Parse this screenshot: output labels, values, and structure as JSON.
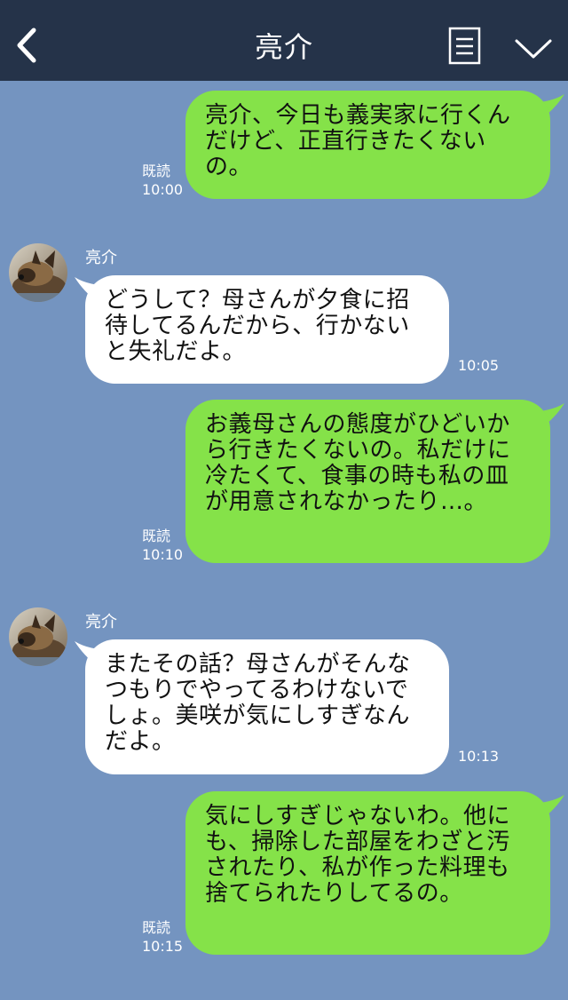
{
  "header": {
    "title": "亮介",
    "back_icon": "chevron-left-icon",
    "menu_icon": "menu-list-icon",
    "collapse_icon": "chevron-down-icon",
    "background": "#253349"
  },
  "chat": {
    "background": "#7494c0",
    "outgoing_color": "#85e249",
    "incoming_color": "#ffffff",
    "messages": [
      {
        "direction": "out",
        "text": "亮介、今日も義実家に行くんだけど、正直行きたくないの。",
        "read_label": "既読",
        "time": "10:00"
      },
      {
        "direction": "in",
        "sender": "亮介",
        "text": "どうして？母さんが夕食に招待してるんだから、行かないと失礼だよ。",
        "time": "10:05"
      },
      {
        "direction": "out",
        "text": "お義母さんの態度がひどいから行きたくないの。私だけに冷たくて、食事の時も私の皿が用意されなかったり…。",
        "read_label": "既読",
        "time": "10:10"
      },
      {
        "direction": "in",
        "sender": "亮介",
        "text": "またその話？母さんがそんなつもりでやってるわけないでしょ。美咲が気にしすぎなんだよ。",
        "time": "10:13"
      },
      {
        "direction": "out",
        "text": "気にしすぎじゃないわ。他にも、掃除した部屋をわざと汚されたり、私が作った料理も捨てられたりしてるの。",
        "read_label": "既読",
        "time": "10:15"
      }
    ]
  }
}
